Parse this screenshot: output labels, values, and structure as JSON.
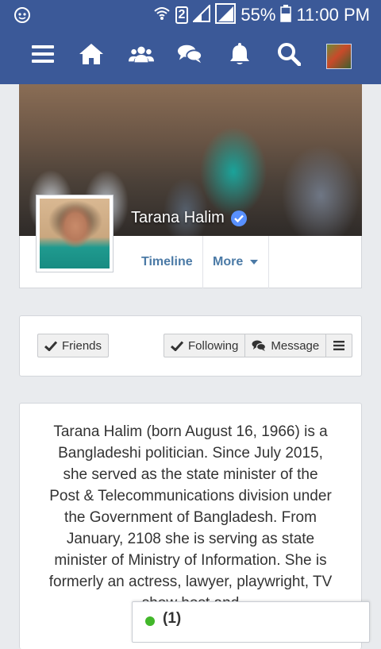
{
  "status_bar": {
    "battery": "55%",
    "time": "11:00 PM",
    "sim_badge": "2",
    "icons": [
      "notification-bot-icon",
      "wifi-icon",
      "sim-2-icon",
      "signal-icon",
      "signal-icon",
      "battery-icon"
    ]
  },
  "nav": {
    "icons": [
      "menu-icon",
      "home-icon",
      "friends-icon",
      "messages-icon",
      "notifications-icon",
      "search-icon",
      "avatar"
    ]
  },
  "profile": {
    "name": "Tarana Halim",
    "verified": true,
    "tabs": {
      "timeline": "Timeline",
      "more": "More"
    }
  },
  "actions": {
    "friends": "Friends",
    "following": "Following",
    "message": "Message"
  },
  "bio": {
    "text": "Tarana Halim (born August 16, 1966) is a Bangladeshi politician. Since July 2015, she served as the state minister of the Post & Telecommunications division under the Government of Bangladesh. From January, 2108 she is serving as state minister of Ministry of Information. She is formerly an actress, lawyer, playwright, TV show host and"
  },
  "chat": {
    "online_count": "(1)",
    "status_color": "#42b72a"
  },
  "colors": {
    "brand": "#3b5998",
    "link": "#4b7aa6",
    "verified": "#5890ff",
    "background": "#e9ebee"
  }
}
